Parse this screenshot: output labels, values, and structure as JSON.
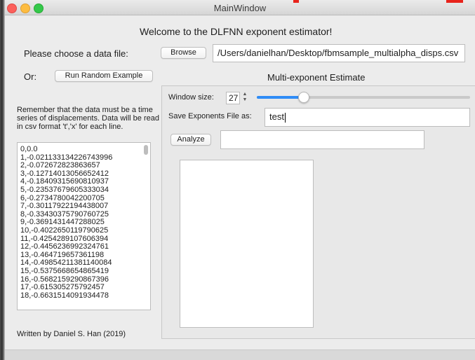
{
  "window": {
    "title": "MainWindow"
  },
  "welcome": "Welcome to the DLFNN exponent estimator!",
  "choose_label": "Please choose a data file:",
  "browse_label": "Browse",
  "file_path": "/Users/danielhan/Desktop/fbmsample_multialpha_disps.csv",
  "or_label": "Or:",
  "random_label": "Run Random Example",
  "multi_title": "Multi-exponent Estimate",
  "note": [
    "Remember that the data must be a time",
    "series of displacements. Data will be read",
    "in csv format 't','x' for each line."
  ],
  "window_size": {
    "label": "Window size:",
    "value": "27",
    "slider_fraction": 0.22
  },
  "save": {
    "label": "Save Exponents File as:",
    "value": "test"
  },
  "analyze_label": "Analyze",
  "analyze_output": "",
  "data_lines": [
    "0,0.0",
    "1,-0.021133134226743996",
    "2,-0.072672823863657",
    "3,-0.12714013056652412",
    "4,-0.18409315690810937",
    "5,-0.23537679605333034",
    "6,-0.2734780042200705",
    "7,-0.30117922194438007",
    "8,-0.33430375790760725",
    "9,-0.3691431447288025",
    "10,-0.4022650119790625",
    "11,-0.4254289107606394",
    "12,-0.4456236992324761",
    "13,-0.464719657361198",
    "14,-0.49854211381140084",
    "15,-0.5375668654865419",
    "16,-0.5682159290867396",
    "17,-0.615305275792457",
    "18,-0.6631514091934478"
  ],
  "footer": "Written by Daniel S. Han (2019)",
  "colors": {
    "accent": "#2f8cf6",
    "annotation": "#e8231c"
  }
}
